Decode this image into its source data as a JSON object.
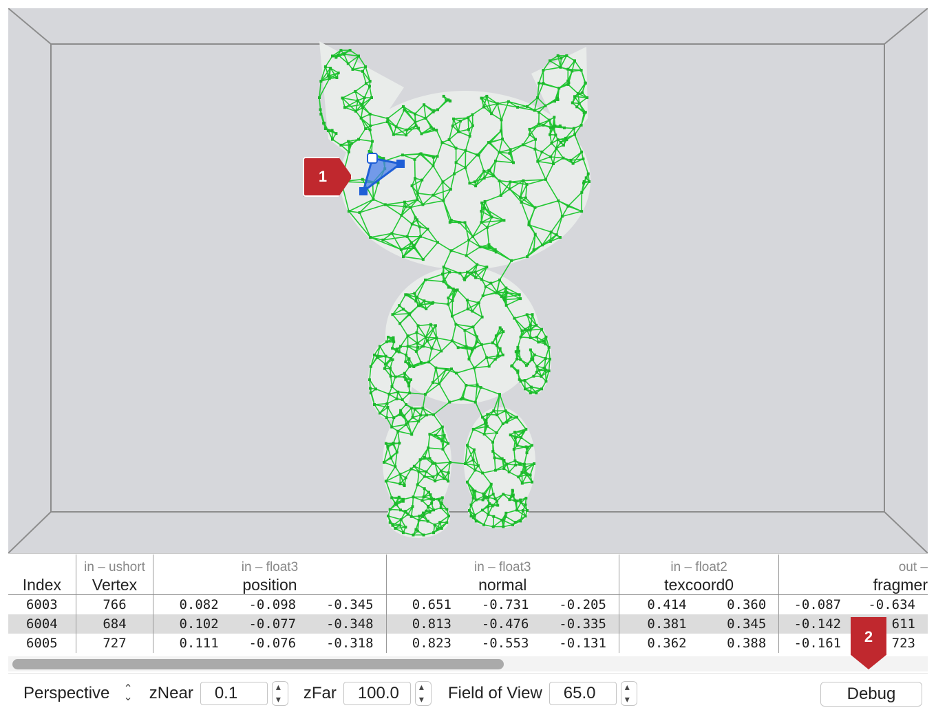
{
  "callouts": {
    "one": "1",
    "two": "2"
  },
  "colors": {
    "mesh": "#22c833",
    "selection": "#1f5fd6",
    "callout": "#c0282e",
    "viewport": "#d6d7db"
  },
  "table": {
    "headers": [
      {
        "sub": "",
        "main": "Index"
      },
      {
        "sub": "in – ushort",
        "main": "Vertex"
      },
      {
        "sub": "in – float3",
        "main": "position"
      },
      {
        "sub": "in – float3",
        "main": "normal"
      },
      {
        "sub": "in – float2",
        "main": "texcoord0"
      },
      {
        "sub": "out –",
        "main": "fragmer"
      }
    ],
    "rows": [
      {
        "index": "6003",
        "vertex": "766",
        "pos": [
          "0.082",
          "-0.098",
          "-0.345"
        ],
        "nrm": [
          "0.651",
          "-0.731",
          "-0.205"
        ],
        "uv": [
          "0.414",
          "0.360"
        ],
        "out": [
          "-0.087",
          "-0.634"
        ]
      },
      {
        "index": "6004",
        "vertex": "684",
        "pos": [
          "0.102",
          "-0.077",
          "-0.348"
        ],
        "nrm": [
          "0.813",
          "-0.476",
          "-0.335"
        ],
        "uv": [
          "0.381",
          "0.345"
        ],
        "out": [
          "-0.142",
          "611"
        ]
      },
      {
        "index": "6005",
        "vertex": "727",
        "pos": [
          "0.111",
          "-0.076",
          "-0.318"
        ],
        "nrm": [
          "0.823",
          "-0.553",
          "-0.131"
        ],
        "uv": [
          "0.362",
          "0.388"
        ],
        "out": [
          "-0.161",
          "723"
        ]
      }
    ]
  },
  "controls": {
    "projection": "Perspective",
    "znear_label": "zNear",
    "znear_value": "0.1",
    "zfar_label": "zFar",
    "zfar_value": "100.0",
    "fov_label": "Field of View",
    "fov_value": "65.0",
    "debug_label": "Debug"
  }
}
